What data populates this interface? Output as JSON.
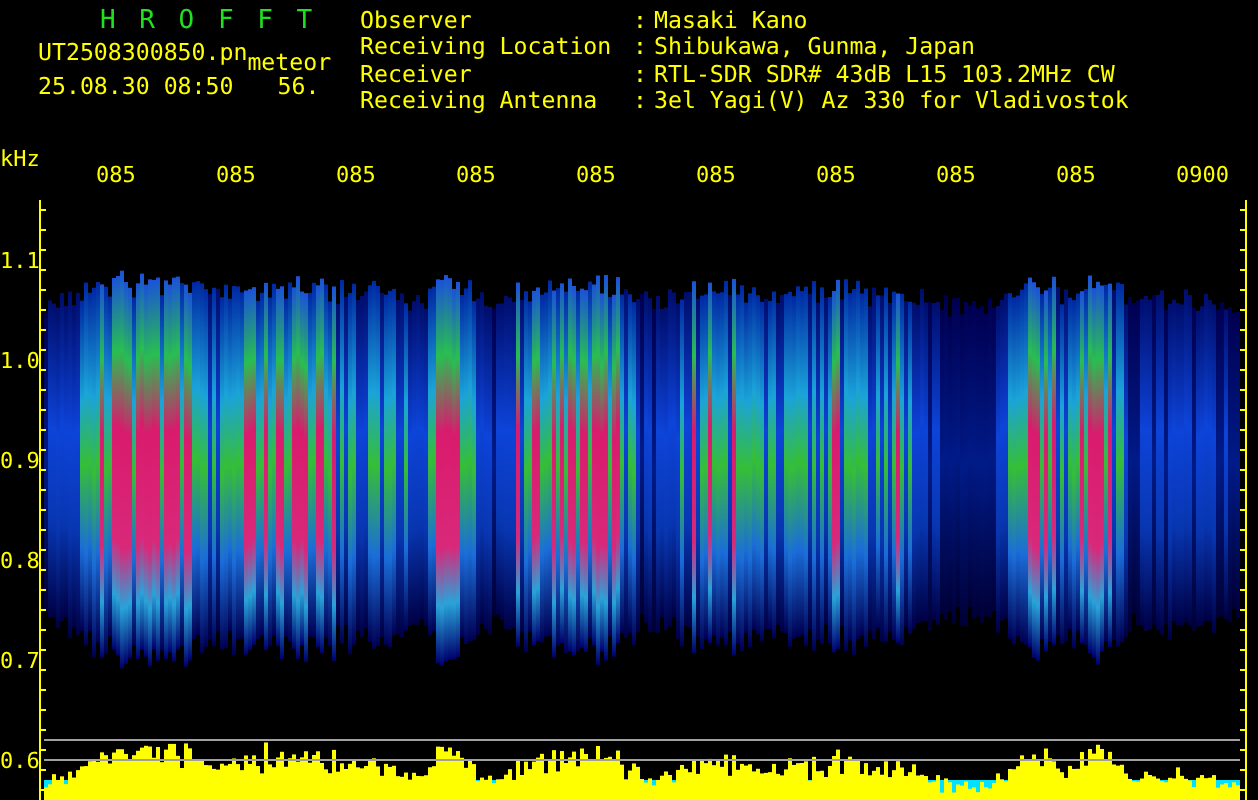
{
  "header": {
    "title": "H R O F F T",
    "file_name": "UT2508300850.pn",
    "tag": "meteor",
    "timestamp": "25.08.30 08:50",
    "count": "56.",
    "fields": [
      {
        "label": "Observer",
        "separator": ":",
        "value": "Masaki Kano"
      },
      {
        "label": "Receiving Location",
        "separator": ":",
        "value": "Shibukawa, Gunma, Japan"
      },
      {
        "label": "Receiver",
        "separator": ":",
        "value": "RTL-SDR SDR# 43dB L15 103.2MHz CW"
      },
      {
        "label": "Receiving Antenna",
        "separator": ":",
        "value": "3el Yagi(V) Az 330 for Vladivostok"
      }
    ]
  },
  "plot": {
    "unit": "kHz",
    "time_labels": [
      "085",
      "085",
      "085",
      "085",
      "085",
      "085",
      "085",
      "085",
      "085",
      "0900"
    ],
    "frequency_labels": [
      "1.1",
      "1.0",
      "0.9",
      "0.8",
      "0.7",
      "0.6"
    ]
  }
}
